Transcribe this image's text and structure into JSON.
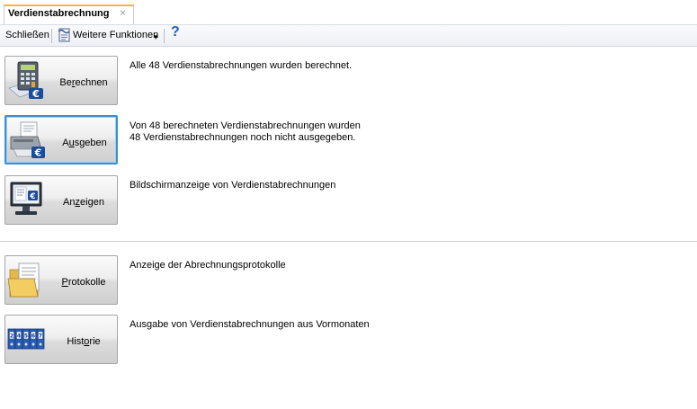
{
  "tab": {
    "title": "Verdienstabrechnung",
    "close_glyph": "×"
  },
  "toolbar": {
    "close_label": "Schließen",
    "more_functions_label": "Weitere Funktionen",
    "more_functions_icon": "document-script-icon",
    "dropdown_glyph": "▾",
    "help_icon": "help-question-icon",
    "help_glyph": "?"
  },
  "actions": [
    {
      "label_pre": "Be",
      "label_accel": "r",
      "label_post": "echnen",
      "icon": "calculator-icon",
      "description": [
        "Alle 48 Verdienstabrechnungen wurden berechnet."
      ]
    },
    {
      "label_pre": "A",
      "label_accel": "u",
      "label_post": "sgeben",
      "icon": "printer-icon",
      "description": [
        "Von 48 berechneten Verdienstabrechnungen wurden",
        "48 Verdienstabrechnungen noch nicht ausgegeben."
      ]
    },
    {
      "label_pre": "An",
      "label_accel": "z",
      "label_post": "eigen",
      "icon": "monitor-icon",
      "description": [
        "Bildschirmanzeige von Verdienstabrechnungen"
      ]
    },
    {
      "label_pre": "",
      "label_accel": "P",
      "label_post": "rotokolle",
      "icon": "folder-document-icon",
      "description": [
        "Anzeige der Abrechnungsprotokolle"
      ]
    },
    {
      "label_pre": "Hist",
      "label_accel": "o",
      "label_post": "rie",
      "icon": "binders-icon",
      "description": [
        "Ausgabe von Verdienstabrechnungen aus Vormonaten"
      ]
    }
  ],
  "binder_labels": [
    "2",
    "4",
    "5",
    "6",
    "7"
  ],
  "colors": {
    "tab_accent": "#f2b345",
    "focus_border": "#3a8fd2",
    "help_icon": "#1f5fbf",
    "euro_badge": "#1b4d9c"
  }
}
